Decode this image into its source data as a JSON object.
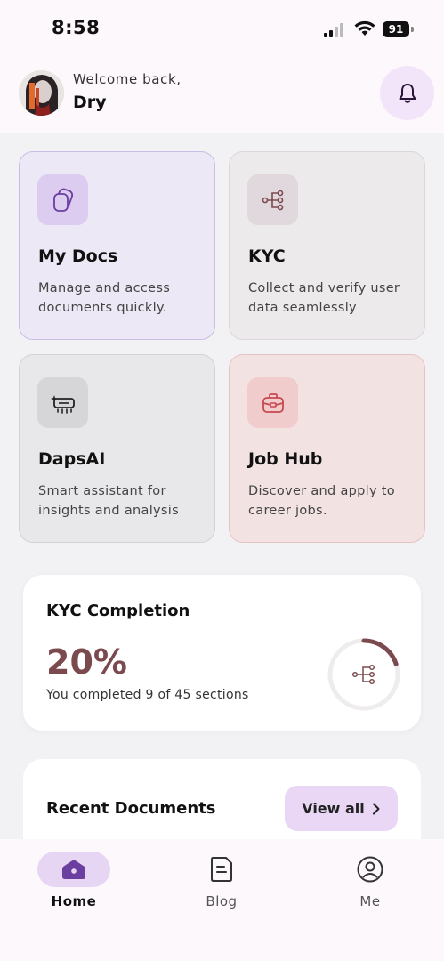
{
  "status_bar": {
    "time": "8:58",
    "battery": "91"
  },
  "header": {
    "welcome": "Welcome back,",
    "username": "Dry"
  },
  "cards": [
    {
      "title": "My Docs",
      "desc": "Manage and access documents quickly.",
      "icon": "documents-icon"
    },
    {
      "title": "KYC",
      "desc": "Collect and verify user data seamlessly",
      "icon": "flow-network-icon"
    },
    {
      "title": "DapsAI",
      "desc": "Smart assistant for insights and analysis",
      "icon": "ai-sparkle-icon"
    },
    {
      "title": "Job Hub",
      "desc": "Discover and apply to career jobs.",
      "icon": "briefcase-icon"
    }
  ],
  "kyc": {
    "title": "KYC Completion",
    "percent_label": "20%",
    "progress_fraction": 0.2,
    "subtitle": "You completed 9 of 45 sections"
  },
  "recent": {
    "title": "Recent Documents",
    "view_all": "View all"
  },
  "nav": [
    {
      "label": "Home",
      "active": true,
      "icon": "home-icon"
    },
    {
      "label": "Blog",
      "active": false,
      "icon": "blog-icon"
    },
    {
      "label": "Me",
      "active": false,
      "icon": "profile-icon"
    }
  ],
  "colors": {
    "accent_purple": "#6a3fa0",
    "kyc_accent": "#7a4a4e",
    "job_accent": "#c9484f"
  }
}
